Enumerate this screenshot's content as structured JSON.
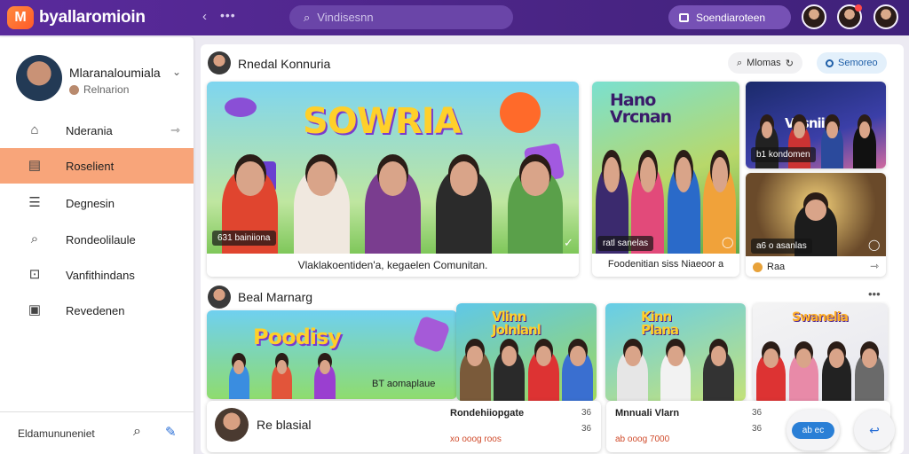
{
  "app": {
    "logo_letter": "M",
    "brand": "byallaromioin"
  },
  "topbar": {
    "back_icon": "‹",
    "more_icon": "•••",
    "search_placeholder": "Vindisesnn",
    "action_button_label": "Soendiaroteen",
    "accent": "#4a2585"
  },
  "sidebar": {
    "profile_name": "Mlaranaloumiala",
    "profile_sub": "Relnarion",
    "items": [
      {
        "label": "Nderania",
        "icon": "home-icon"
      },
      {
        "label": "Roselient",
        "icon": "document-icon",
        "active": true
      },
      {
        "label": "Degnesin",
        "icon": "list-icon"
      },
      {
        "label": "Rondeolilaule",
        "icon": "search-icon"
      },
      {
        "label": "Vanfithindans",
        "icon": "gallery-icon"
      },
      {
        "label": "Revedenen",
        "icon": "calendar-icon"
      }
    ],
    "footer_label": "Eldamununeniet",
    "active_color": "#f8a57a"
  },
  "section1": {
    "title": "Rnedal Konnuria",
    "filter_label": "Mlomas",
    "sort_label": "Semoreo",
    "hero": {
      "art_title": "SOWRIA",
      "tag": "631 bainiiona",
      "caption": "Vlaklakoentiden'a, kegaelen Comunitan."
    },
    "card2": {
      "art_title": "Hano Vrcnan",
      "tag": "ratl sanelas",
      "caption": "Foodenitian siss Niaeoor a"
    },
    "card3a": {
      "art_title": "Vasniisa",
      "tag": "b1 kondomen"
    },
    "card3b": {
      "tag": "a6 o asanlas",
      "caption": "Raa"
    }
  },
  "section2": {
    "title": "Beal Marnarg",
    "card1": {
      "art_title": "Poodisy",
      "tag": "BT aomaplaue"
    },
    "card2": {
      "art_title": "Vlinn Jolnlanl"
    },
    "card3": {
      "art_title": "Kinn Plana"
    },
    "card4": {
      "art_title": "Swanelia"
    },
    "bottom1": {
      "title": "Re blasial"
    },
    "bottom2": {
      "title": "Rondehiiopgate",
      "meta": "xo ooog roos",
      "badge": "36"
    },
    "bottom3": {
      "title": "Mnnuali Vlarn",
      "meta": "ab ooog 7000",
      "badge": "36"
    },
    "round_btn_label": "ab ec"
  }
}
